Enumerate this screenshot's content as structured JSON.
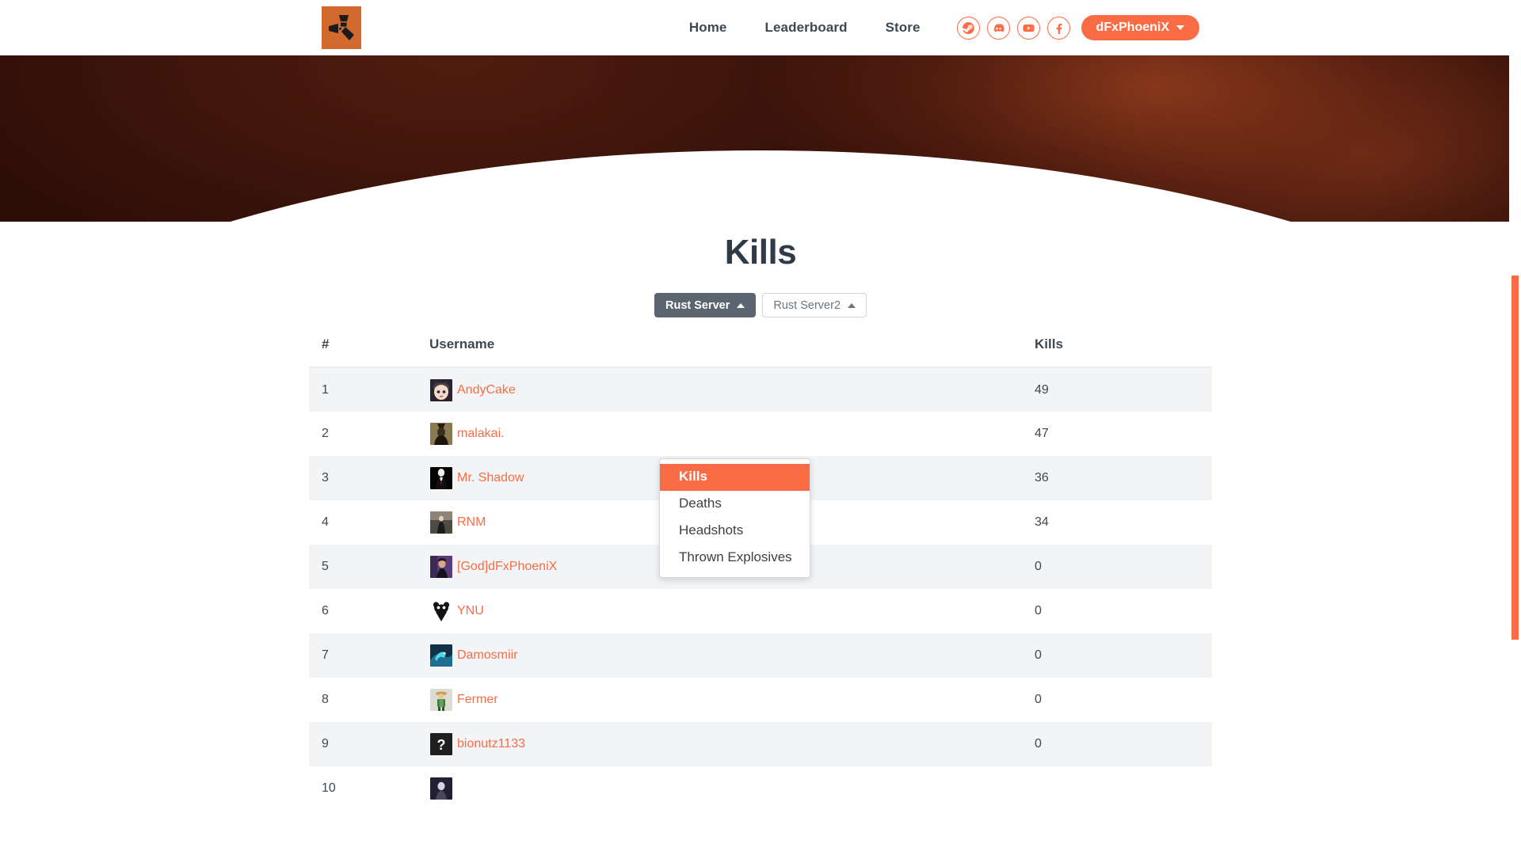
{
  "brand": {
    "logo_icon": "rust-logo-icon",
    "accent_color": "#fa6c46",
    "logo_bg_color": "#d2692f"
  },
  "navbar": {
    "links": [
      {
        "label": "Home",
        "name": "nav-link-home"
      },
      {
        "label": "Leaderboard",
        "name": "nav-link-leaderboard"
      },
      {
        "label": "Store",
        "name": "nav-link-store"
      }
    ],
    "social": [
      {
        "icon": "steam-icon",
        "label": "Steam"
      },
      {
        "icon": "discord-icon",
        "label": "Discord"
      },
      {
        "icon": "youtube-icon",
        "label": "YouTube"
      },
      {
        "icon": "facebook-icon",
        "label": "Facebook"
      }
    ],
    "user": {
      "name": "dFxPhoeniX",
      "caret": "caret-down-icon"
    }
  },
  "hero": {
    "scroll_indicator": "scroll-down-indicator"
  },
  "main": {
    "title": "Kills",
    "stat_dropdown": {
      "open": true,
      "selected": "Kills",
      "options": [
        "Kills",
        "Deaths",
        "Headshots",
        "Thrown Explosives"
      ]
    },
    "servers": [
      {
        "label": "Rust Server",
        "active": true
      },
      {
        "label": "Rust Server2",
        "active": false
      }
    ]
  },
  "table": {
    "columns": [
      "#",
      "Username",
      "Kills"
    ],
    "rows": [
      {
        "rank": "1",
        "username": "AndyCake",
        "value": "49",
        "avatar": "avatar-anime-girl"
      },
      {
        "rank": "2",
        "username": "malakai.",
        "value": "47",
        "avatar": "avatar-dark-figure"
      },
      {
        "rank": "3",
        "username": "Mr. Shadow",
        "value": "36",
        "avatar": "avatar-slenderman"
      },
      {
        "rank": "4",
        "username": "RNM",
        "value": "34",
        "avatar": "avatar-street-photo"
      },
      {
        "rank": "5",
        "username": "[God]dFxPhoeniX",
        "value": "0",
        "avatar": "avatar-portrait-purple"
      },
      {
        "rank": "6",
        "username": "YNU",
        "value": "0",
        "avatar": "avatar-panda-logo"
      },
      {
        "rank": "7",
        "username": "Damosmiir",
        "value": "0",
        "avatar": "avatar-blue-dragon"
      },
      {
        "rank": "8",
        "username": "Fermer",
        "value": "0",
        "avatar": "avatar-farmer-cartoon"
      },
      {
        "rank": "9",
        "username": "bionutz1133",
        "value": "0",
        "avatar": "avatar-question-mark"
      },
      {
        "rank": "10",
        "username": "",
        "value": "",
        "avatar": "avatar-unknown"
      }
    ]
  },
  "scrollbar": {
    "thumb_color": "#fa6c46"
  }
}
